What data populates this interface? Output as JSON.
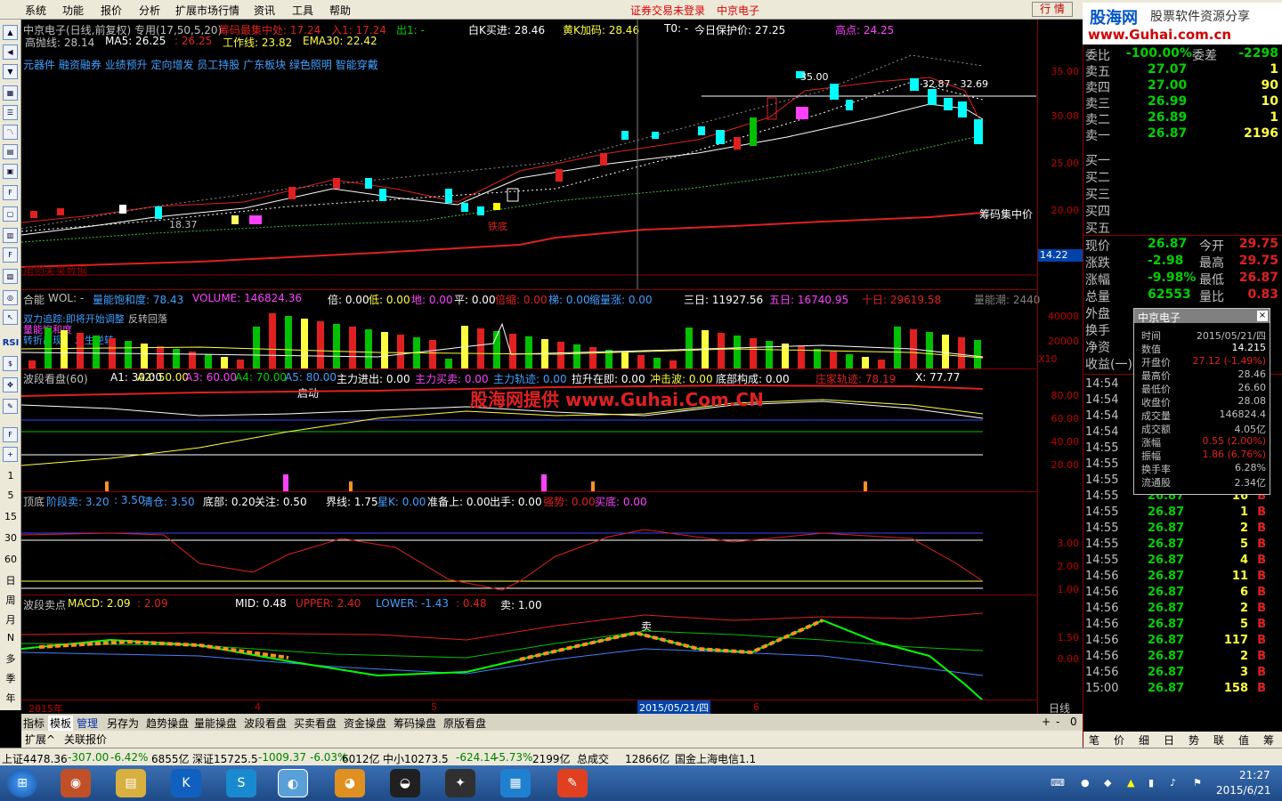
{
  "menu": [
    "系统",
    "功能",
    "报价",
    "分析",
    "扩展市场行情",
    "资讯",
    "工具",
    "帮助"
  ],
  "top_status": "证券交易未登录",
  "top_stock": "中京电子",
  "hq_button": "行 情",
  "brand": {
    "name": "股海网",
    "sub": "股票软件资源分享",
    "url": "www.Guhai.com.cn"
  },
  "chart": {
    "title": "中京电子(日线,前复权) 专用(17,50,5,20)",
    "main_labels": {
      "chip": "筹码最集中处: 17.24",
      "entry": "入1: 17.24",
      "out": "出1: -",
      "white_k": "白K买进: 28.46",
      "yellow_k": "黄K加码: 28.46",
      "t0": "T0: -",
      "protect": "今日保护价: 27.25",
      "high": "高点: 24.25",
      "hp": "高抛线: 28.14",
      "ma5": "MA5: 26.25",
      "ma5b": ": 26.25",
      "work": "工作线: 23.82",
      "ema30": "EMA30: 22.42"
    },
    "concepts": "元器件 融资融券 业绩预升 定向增发 员工持股 广东板块 绿色照明 智能穿戴",
    "price_axis": [
      "35.00",
      "30.00",
      "25.00",
      "20.00"
    ],
    "cur_price_tag": "14.22",
    "annot": {
      "high_price": "35.00",
      "range": "32.87 - 32.69",
      "low": "18.37",
      "iron": "铁底",
      "chip_line": "筹码集中价",
      "future": "用到未来数据"
    },
    "vol": {
      "name": "合能",
      "wol": "WOL: -",
      "sat": "量能饱和度: 78.43",
      "volume": "VOLUME: 146824.36",
      "bei": "倍: 0.00",
      "low": "低: 0.00",
      "di": "地: 0.00",
      "ping": "平: 0.00",
      "beishu": "倍缩: 0.00",
      "tai": "梯: 0.00",
      "suo": "缩量涨: 0.00",
      "d3": "三日: 11927.56",
      "d5": "五日: 16740.95",
      "d10": "十日: 29619.58",
      "qnc": "量能潮: 2440",
      "axis": [
        "40000",
        "20000"
      ],
      "x10": "X10",
      "notes": [
        "双力追踪:即将开始调整",
        "量能饱和度",
        "反转回落",
        "转折出现",
        "发生逆转"
      ]
    },
    "wave": {
      "name": "波段看盘(60)",
      "a1": "A1: 30.00",
      "a2": "A2: 50.00",
      "a3": "A3: 60.00",
      "a4": "A4: 70.00",
      "a5": "A5: 80.00",
      "zljc": "主力进出: 0.00",
      "zlmm": "主力买卖: 0.00",
      "zlgj": "主力轨迹: 0.00",
      "lsz": "拉升在即: 0.00",
      "cjb": "冲击波: 0.00",
      "dbgc": "底部构成: 0.00",
      "zjgj": "庄家轨迹: 78.19",
      "x": "X: 77.77",
      "qidong": "启动",
      "axis": [
        "80.00",
        "60.00",
        "40.00",
        "20.00"
      ]
    },
    "watermark": "股海网提供 www.Guhai.Com.CN",
    "top": {
      "name": "顶底",
      "jdm": "阶段卖: 3.20",
      "jdm2": ": 3.50",
      "qc": "清仓: 3.50",
      "db": "底部: 0.20",
      "gz": "关注: 0.50",
      "jx": "界线: 1.75",
      "xk": "星K: 0.00",
      "zbs": "准备上: 0.00",
      "cs": "出手: 0.00",
      "qs": "强势: 0.00",
      "md": "买底: 0.00",
      "axis": [
        "3.00",
        "2.00",
        "1.00"
      ]
    },
    "macd": {
      "name": "波段卖点",
      "macd": "MACD: 2.09",
      "macd2": ": 2.09",
      "mid": "MID: 0.48",
      "upper": "UPPER: 2.40",
      "lower": "LOWER: -1.43",
      "v": ": 0.48",
      "sell": "卖: 1.00",
      "axis": [
        "1.50",
        "0.00"
      ],
      "sell_tag": "卖"
    },
    "dates": {
      "year": "2015年",
      "m4": "4",
      "m5": "5",
      "cursor": "2015/05/21/四",
      "m6": "6",
      "period": "日线"
    }
  },
  "left_toolbar_text": [
    "RSI",
    "日",
    "周",
    "月",
    "N",
    "多",
    "季",
    "年",
    "1",
    "5",
    "15",
    "30",
    "60"
  ],
  "bottom_tabs": [
    "指标",
    "模板",
    "管理",
    "另存为",
    "趋势操盘",
    "量能操盘",
    "波段看盘",
    "买卖看盘",
    "资金操盘",
    "筹码操盘",
    "原版看盘"
  ],
  "bottom_tabs2": [
    "扩展^",
    "关联报价"
  ],
  "order_book": {
    "header": {
      "wb": "委比",
      "wbv": "-100.00%",
      "wc": "委差",
      "wcv": "-2298"
    },
    "sell": [
      {
        "n": "卖五",
        "p": "27.07",
        "v": "1"
      },
      {
        "n": "卖四",
        "p": "27.00",
        "v": "90"
      },
      {
        "n": "卖三",
        "p": "26.99",
        "v": "10"
      },
      {
        "n": "卖二",
        "p": "26.89",
        "v": "1"
      },
      {
        "n": "卖一",
        "p": "26.87",
        "v": "2196"
      }
    ],
    "buy": [
      "买一",
      "买二",
      "买三",
      "买四",
      "买五"
    ],
    "stats": [
      {
        "a": "现价",
        "av": "26.87",
        "b": "今开",
        "bv": "29.75"
      },
      {
        "a": "涨跌",
        "av": "-2.98",
        "b": "最高",
        "bv": "29.75"
      },
      {
        "a": "涨幅",
        "av": "-9.98%",
        "b": "最低",
        "bv": "26.87"
      },
      {
        "a": "总量",
        "av": "62553",
        "b": "量比",
        "bv": "0.83"
      },
      {
        "a": "外盘",
        "av": "",
        "b": "",
        "bv": ""
      },
      {
        "a": "换手",
        "av": "",
        "b": "",
        "bv": ""
      },
      {
        "a": "净资",
        "av": "",
        "b": "",
        "bv": ""
      },
      {
        "a": "收益(一)",
        "av": "",
        "b": "",
        "bv": ""
      }
    ]
  },
  "ticks": [
    {
      "t": "14:54"
    },
    {
      "t": "14:54"
    },
    {
      "t": "14:54"
    },
    {
      "t": "14:54"
    },
    {
      "t": "14:55"
    },
    {
      "t": "14:55"
    },
    {
      "t": "14:55",
      "p": "26.87",
      "v": "3",
      "s": "B"
    },
    {
      "t": "14:55",
      "p": "26.87",
      "v": "16",
      "s": "B"
    },
    {
      "t": "14:55",
      "p": "26.87",
      "v": "1",
      "s": "B"
    },
    {
      "t": "14:55",
      "p": "26.87",
      "v": "2",
      "s": "B"
    },
    {
      "t": "14:55",
      "p": "26.87",
      "v": "5",
      "s": "B"
    },
    {
      "t": "14:55",
      "p": "26.87",
      "v": "4",
      "s": "B"
    },
    {
      "t": "14:56",
      "p": "26.87",
      "v": "11",
      "s": "B"
    },
    {
      "t": "14:56",
      "p": "26.87",
      "v": "6",
      "s": "B"
    },
    {
      "t": "14:56",
      "p": "26.87",
      "v": "2",
      "s": "B"
    },
    {
      "t": "14:56",
      "p": "26.87",
      "v": "5",
      "s": "B"
    },
    {
      "t": "14:56",
      "p": "26.87",
      "v": "117",
      "s": "B"
    },
    {
      "t": "14:56",
      "p": "26.87",
      "v": "2",
      "s": "B"
    },
    {
      "t": "14:56",
      "p": "26.87",
      "v": "3",
      "s": "B"
    },
    {
      "t": "15:00",
      "p": "26.87",
      "v": "158",
      "s": "B"
    }
  ],
  "right_tabs": [
    "笔",
    "价",
    "细",
    "日",
    "势",
    "联",
    "值",
    "筹"
  ],
  "popup": {
    "title": "中京电子",
    "rows": [
      {
        "k": "时间",
        "v": "2015/05/21/四"
      },
      {
        "k": "数值",
        "v": "14.215"
      },
      {
        "k": "开盘价",
        "v": "27.12 (-1.49%)"
      },
      {
        "k": "最高价",
        "v": "28.46"
      },
      {
        "k": "最低价",
        "v": "26.60"
      },
      {
        "k": "收盘价",
        "v": "28.08"
      },
      {
        "k": "成交量",
        "v": "146824.4"
      },
      {
        "k": "成交额",
        "v": "4.05亿"
      },
      {
        "k": "涨幅",
        "v": "0.55 (2.00%)"
      },
      {
        "k": "振幅",
        "v": "1.86 (6.76%)"
      },
      {
        "k": "换手率",
        "v": "6.28%"
      },
      {
        "k": "流通股",
        "v": "2.34亿"
      }
    ]
  },
  "statusbar": {
    "sh": "上证4478.36",
    "sh_chg": "-307.00",
    "sh_pct": "-6.42%",
    "sh_amt": "6855亿",
    "sz": "深证15725.5",
    "sz_chg": "-1009.37",
    "sz_pct": "-6.03%",
    "sz_amt": "6012亿",
    "zx": "中小10273.5",
    "zx_chg": "-624.14",
    "zx_pct": "-5.73%",
    "zx_amt": "2199亿",
    "total": "总成交",
    "total_v": "12866亿",
    "site": "国金上海电信1.1"
  },
  "clock": {
    "time": "21:27",
    "date": "2015/6/21"
  }
}
